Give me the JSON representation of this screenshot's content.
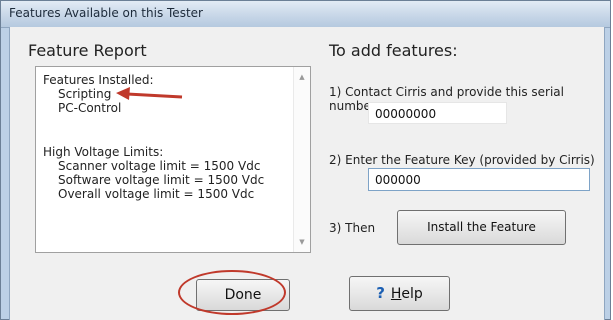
{
  "window": {
    "title": "Features Available on this Tester"
  },
  "report": {
    "heading": "Feature Report",
    "lines": {
      "installed_header": "Features Installed:",
      "feature1": "Scripting",
      "feature2": "PC-Control",
      "hv_header": "High Voltage Limits:",
      "hv1": "Scanner voltage limit = 1500 Vdc",
      "hv2": "Software voltage limit = 1500 Vdc",
      "hv3": "Overall voltage limit = 1500 Vdc"
    }
  },
  "add": {
    "heading": "To add features:",
    "step1": "1) Contact Cirris and provide this serial number:",
    "serial": "00000000",
    "step2": "2) Enter the Feature Key (provided by Cirris)",
    "key_value": "000000",
    "step3": "3) Then",
    "install_label": "Install the Feature"
  },
  "buttons": {
    "done": "Done",
    "help_prefix": "?",
    "help_underlined": "H",
    "help_rest": "elp"
  },
  "annotations": {
    "color": "#c0392b"
  }
}
